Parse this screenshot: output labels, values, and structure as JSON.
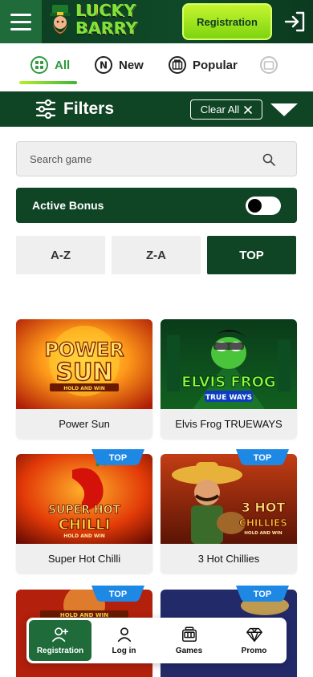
{
  "header": {
    "logo_line1": "LUCKY",
    "logo_line2": "BARRY",
    "registration_label": "Registration",
    "icons": [
      "menu-icon",
      "login-icon"
    ]
  },
  "tabs": [
    {
      "label": "All",
      "icon": "grid-icon",
      "active": true
    },
    {
      "label": "New",
      "icon": "new-icon",
      "active": false
    },
    {
      "label": "Popular",
      "icon": "slot-machine-icon",
      "active": false
    }
  ],
  "filters": {
    "title": "Filters",
    "clear_label": "Clear All"
  },
  "search": {
    "placeholder": "Search game"
  },
  "active_bonus": {
    "label": "Active Bonus",
    "enabled": false
  },
  "sort": {
    "az": "A-Z",
    "za": "Z-A",
    "top": "TOP",
    "selected": "TOP"
  },
  "games": [
    {
      "name": "Power Sun",
      "art_title": "POWER SUN",
      "art_sub": "HOLD AND WIN",
      "badge": ""
    },
    {
      "name": "Elvis Frog TRUEWAYS",
      "art_title": "ELVIS FROG",
      "art_sub": "TRUE WAYS",
      "badge": ""
    },
    {
      "name": "Super Hot Chilli",
      "art_title": "SUPER HOT CHILLI",
      "art_sub": "HOLD AND WIN",
      "badge": "TOP"
    },
    {
      "name": "3 Hot Chillies",
      "art_title": "3 HOT CHILLIES",
      "art_sub": "HOLD AND WIN",
      "badge": "TOP"
    },
    {
      "name": "",
      "art_sub": "HOLD AND WIN",
      "badge": "TOP"
    },
    {
      "name": "",
      "badge": "TOP"
    }
  ],
  "bottom_nav": [
    {
      "label": "Registration",
      "icon": "add-user-icon",
      "active": true
    },
    {
      "label": "Log in",
      "icon": "user-icon",
      "active": false
    },
    {
      "label": "Games",
      "icon": "slot-machine-icon",
      "active": false
    },
    {
      "label": "Promo",
      "icon": "diamond-icon",
      "active": false
    }
  ],
  "colors": {
    "brand_dark_green": "#0f4424",
    "brand_green": "#1f6b3a",
    "accent_lime": "#a6e81c",
    "badge_blue": "#1e88e5"
  }
}
